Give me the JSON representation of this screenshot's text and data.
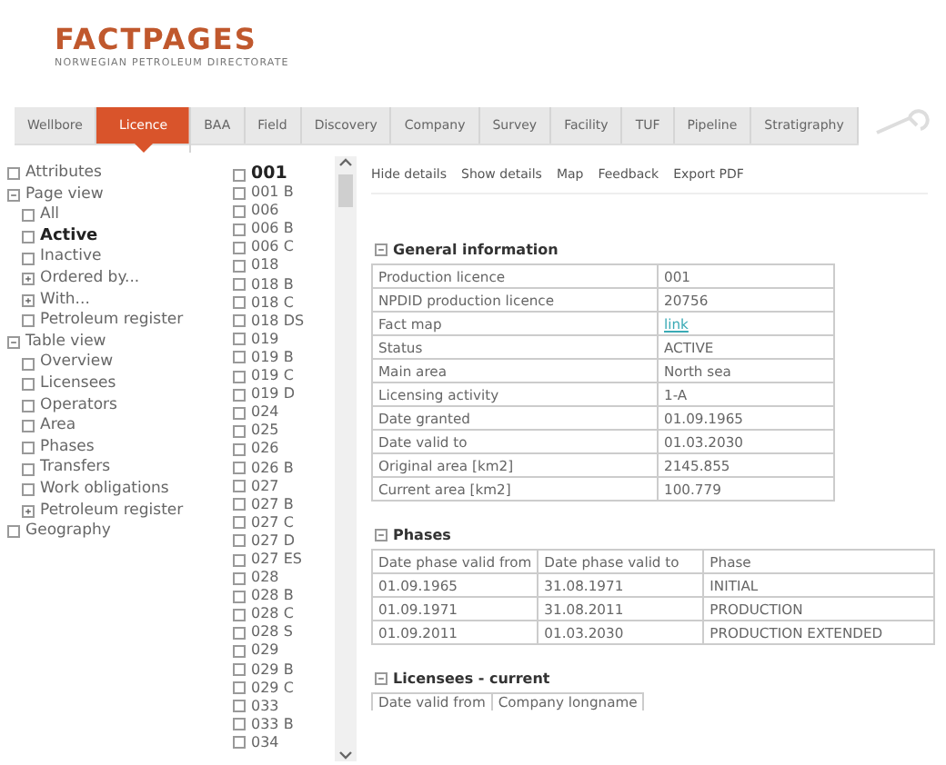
{
  "logo": {
    "title": "FACTPAGES",
    "subtitle": "NORWEGIAN PETROLEUM DIRECTORATE"
  },
  "tabs": [
    {
      "label": "Wellbore",
      "selected": false
    },
    {
      "label": "Licence",
      "selected": true
    },
    {
      "label": "BAA",
      "selected": false
    },
    {
      "label": "Field",
      "selected": false
    },
    {
      "label": "Discovery",
      "selected": false
    },
    {
      "label": "Company",
      "selected": false
    },
    {
      "label": "Survey",
      "selected": false
    },
    {
      "label": "Facility",
      "selected": false
    },
    {
      "label": "TUF",
      "selected": false
    },
    {
      "label": "Pipeline",
      "selected": false
    },
    {
      "label": "Stratigraphy",
      "selected": false
    }
  ],
  "tree": [
    {
      "label": "Attributes",
      "kind": "leaf",
      "selected": false
    },
    {
      "label": "Page view",
      "kind": "expanded",
      "selected": false,
      "children": [
        {
          "label": "All",
          "kind": "leaf",
          "selected": false
        },
        {
          "label": "Active",
          "kind": "leaf",
          "selected": true
        },
        {
          "label": "Inactive",
          "kind": "leaf",
          "selected": false
        },
        {
          "label": "Ordered by...",
          "kind": "collapsed",
          "selected": false
        },
        {
          "label": "With...",
          "kind": "collapsed",
          "selected": false
        },
        {
          "label": "Petroleum register",
          "kind": "leaf",
          "selected": false
        }
      ]
    },
    {
      "label": "Table view",
      "kind": "expanded",
      "selected": false,
      "children": [
        {
          "label": "Overview",
          "kind": "leaf",
          "selected": false
        },
        {
          "label": "Licensees",
          "kind": "leaf",
          "selected": false
        },
        {
          "label": "Operators",
          "kind": "leaf",
          "selected": false
        },
        {
          "label": "Area",
          "kind": "leaf",
          "selected": false
        },
        {
          "label": "Phases",
          "kind": "leaf",
          "selected": false
        },
        {
          "label": "Transfers",
          "kind": "leaf",
          "selected": false
        },
        {
          "label": "Work obligations",
          "kind": "leaf",
          "selected": false
        },
        {
          "label": "Petroleum register",
          "kind": "collapsed",
          "selected": false
        }
      ]
    },
    {
      "label": "Geography",
      "kind": "leaf",
      "selected": false
    }
  ],
  "licences": [
    {
      "label": "001",
      "selected": true
    },
    {
      "label": "001 B",
      "selected": false
    },
    {
      "label": "006",
      "selected": false
    },
    {
      "label": "006 B",
      "selected": false
    },
    {
      "label": "006 C",
      "selected": false
    },
    {
      "label": "018",
      "selected": false
    },
    {
      "label": "018 B",
      "selected": false
    },
    {
      "label": "018 C",
      "selected": false
    },
    {
      "label": "018 DS",
      "selected": false
    },
    {
      "label": "019",
      "selected": false
    },
    {
      "label": "019 B",
      "selected": false
    },
    {
      "label": "019 C",
      "selected": false
    },
    {
      "label": "019 D",
      "selected": false
    },
    {
      "label": "024",
      "selected": false
    },
    {
      "label": "025",
      "selected": false
    },
    {
      "label": "026",
      "selected": false
    },
    {
      "label": "026 B",
      "selected": false
    },
    {
      "label": "027",
      "selected": false
    },
    {
      "label": "027 B",
      "selected": false
    },
    {
      "label": "027 C",
      "selected": false
    },
    {
      "label": "027 D",
      "selected": false
    },
    {
      "label": "027 ES",
      "selected": false
    },
    {
      "label": "028",
      "selected": false
    },
    {
      "label": "028 B",
      "selected": false
    },
    {
      "label": "028 C",
      "selected": false
    },
    {
      "label": "028 S",
      "selected": false
    },
    {
      "label": "029",
      "selected": false
    },
    {
      "label": "029 B",
      "selected": false
    },
    {
      "label": "029 C",
      "selected": false
    },
    {
      "label": "033",
      "selected": false
    },
    {
      "label": "033 B",
      "selected": false
    },
    {
      "label": "034",
      "selected": false
    }
  ],
  "toolbar": [
    "Hide details",
    "Show details",
    "Map",
    "Feedback",
    "Export PDF"
  ],
  "general_information": {
    "title": "General information",
    "rows": [
      {
        "label": "Production licence",
        "value": "001",
        "kind": "text"
      },
      {
        "label": "NPDID production licence",
        "value": "20756",
        "kind": "text"
      },
      {
        "label": "Fact map",
        "value": "link",
        "kind": "link"
      },
      {
        "label": "Status",
        "value": "ACTIVE",
        "kind": "text"
      },
      {
        "label": "Main area",
        "value": "North sea",
        "kind": "text"
      },
      {
        "label": "Licensing activity",
        "value": "1-A",
        "kind": "text"
      },
      {
        "label": "Date granted",
        "value": "01.09.1965",
        "kind": "text"
      },
      {
        "label": "Date valid to",
        "value": "01.03.2030",
        "kind": "text"
      },
      {
        "label": "Original area [km2]",
        "value": "2145.855",
        "kind": "text"
      },
      {
        "label": "Current area [km2]",
        "value": "100.779",
        "kind": "text"
      }
    ]
  },
  "phases": {
    "title": "Phases",
    "columns": [
      "Date phase valid from",
      "Date phase valid to",
      "Phase"
    ],
    "rows": [
      [
        "01.09.1965",
        "31.08.1971",
        "INITIAL"
      ],
      [
        "01.09.1971",
        "31.08.2011",
        "PRODUCTION"
      ],
      [
        "01.09.2011",
        "01.03.2030",
        "PRODUCTION EXTENDED"
      ]
    ]
  },
  "licensees_current": {
    "title": "Licensees - current",
    "columns": [
      "Date valid from",
      "Company longname"
    ]
  }
}
